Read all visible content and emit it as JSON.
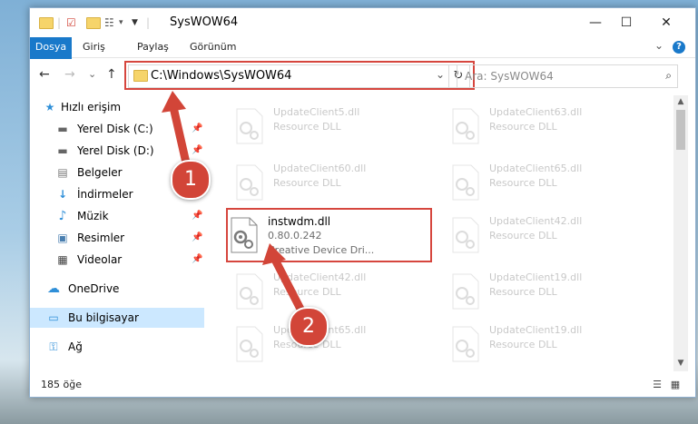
{
  "window": {
    "title": "SysWOW64",
    "controls": {
      "minimize": "—",
      "maximize": "☐",
      "close": "✕"
    }
  },
  "ribbon": {
    "tabs": [
      "Dosya",
      "Giriş",
      "Paylaş",
      "Görünüm"
    ],
    "expand_glyph": "⌄",
    "help_glyph": "?"
  },
  "navigation": {
    "back_glyph": "←",
    "forward_glyph": "→",
    "recent_glyph": "⌄",
    "up_glyph": "↑",
    "address": "C:\\Windows\\SysWOW64",
    "address_dropdown_glyph": "⌄",
    "refresh_glyph": "↻",
    "search_placeholder": "Ara: SysWOW64",
    "search_glyph": "⌕"
  },
  "sidebar": {
    "items": [
      {
        "label": "Hızlı erişim",
        "icon": "star-icon",
        "glyph": "★",
        "color": "#2f8fd8"
      },
      {
        "label": "Yerel Disk (C:)",
        "icon": "drive-icon",
        "glyph": "▬",
        "color": "#666666",
        "pinned": true
      },
      {
        "label": "Yerel Disk (D:)",
        "icon": "drive-icon",
        "glyph": "▬",
        "color": "#666666",
        "pinned": true
      },
      {
        "label": "Belgeler",
        "icon": "documents-icon",
        "glyph": "▤",
        "color": "#7a7a7a",
        "pinned": true
      },
      {
        "label": "İndirmeler",
        "icon": "download-icon",
        "glyph": "↓",
        "color": "#2f8fd8",
        "pinned": true
      },
      {
        "label": "Müzik",
        "icon": "music-icon",
        "glyph": "♪",
        "color": "#2f8fd8",
        "pinned": true
      },
      {
        "label": "Resimler",
        "icon": "pictures-icon",
        "glyph": "▣",
        "color": "#4a7fb0",
        "pinned": true
      },
      {
        "label": "Videolar",
        "icon": "video-icon",
        "glyph": "▦",
        "color": "#444444",
        "pinned": true
      },
      {
        "label": "OneDrive",
        "icon": "cloud-icon",
        "glyph": "☁",
        "color": "#2f8fd8"
      },
      {
        "label": "Bu bilgisayar",
        "icon": "computer-icon",
        "glyph": "▭",
        "color": "#2f8fd8",
        "selected": true
      },
      {
        "label": "Ağ",
        "icon": "network-icon",
        "glyph": "⚿",
        "color": "#2f8fd8"
      }
    ],
    "pin_glyph": "📌"
  },
  "files": [
    {
      "name": "UpdateClient5.dll",
      "type": "Resource DLL",
      "faded": true
    },
    {
      "name": "UpdateClient63.dll",
      "type": "Resource DLL",
      "faded": true
    },
    {
      "name": "UpdateClient60.dll",
      "type": "Resource DLL",
      "faded": true
    },
    {
      "name": "UpdateClient65.dll",
      "type": "Resource DLL",
      "faded": true
    },
    {
      "name": "instwdm.dll",
      "version": "0.80.0.242",
      "description": "Creative Device Dri...",
      "faded": false
    },
    {
      "name": "UpdateClient42.dll",
      "type": "Resource DLL",
      "faded": true
    },
    {
      "name": "UpdateClient42.dll",
      "type": "Resource DLL",
      "faded": true
    },
    {
      "name": "UpdateClient19.dll",
      "type": "Resource DLL",
      "faded": true
    },
    {
      "name": "UpdateClient65.dll",
      "type": "Resource DLL",
      "faded": true
    },
    {
      "name": "UpdateClient19.dll",
      "type": "Resource DLL",
      "faded": true
    }
  ],
  "status": {
    "count": "185 öğe",
    "details_view_glyph": "☰",
    "tiles_view_glyph": "▦"
  },
  "annotations": {
    "step1": "1",
    "step2": "2",
    "highlight_color": "#d6463e"
  }
}
